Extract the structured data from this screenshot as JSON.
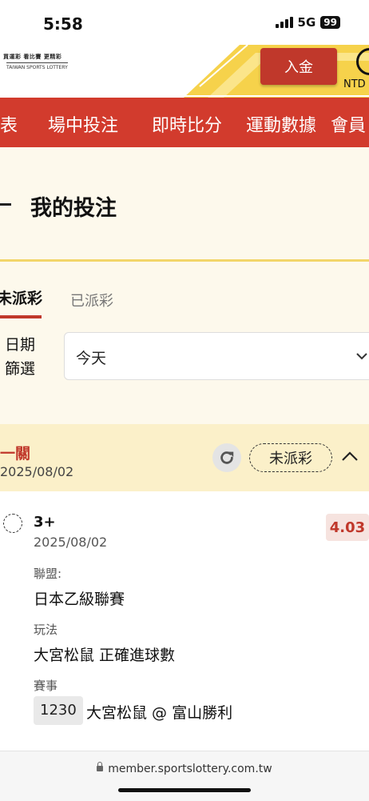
{
  "status_bar": {
    "time": "5:58",
    "network": "5G",
    "battery": "99"
  },
  "header": {
    "logo_line1": "買運彩 看比賽 更精彩",
    "logo_line2": "TAIWAN SPORTS LOTTERY",
    "deposit_label": "入金",
    "currency": "NTD"
  },
  "nav": {
    "items": [
      "賽表",
      "場中投注",
      "即時比分",
      "運動數據",
      "會員"
    ]
  },
  "page": {
    "title": "我的投注"
  },
  "tabs": {
    "active": "未派彩",
    "inactive": "已派彩"
  },
  "filter": {
    "label_line1": "日期",
    "label_line2": "篩選",
    "selected": "今天"
  },
  "bet": {
    "type": "一關",
    "date": "2025/08/02",
    "status": "未派彩",
    "selection": "3+",
    "selection_date": "2025/08/02",
    "odds": "4.03",
    "league_label": "聯盟:",
    "league": "日本乙級聯賽",
    "market_label": "玩法",
    "market": "大宮松鼠 正確進球數",
    "event_label": "賽事",
    "match_id": "1230",
    "match": "大宮松鼠 @ 富山勝利"
  },
  "browser": {
    "url": "member.sportslottery.com.tw"
  },
  "colors": {
    "brand_red": "#d23b2d",
    "accent_yellow": "#f2d66a",
    "bet_header_bg": "#fbf0c9"
  }
}
